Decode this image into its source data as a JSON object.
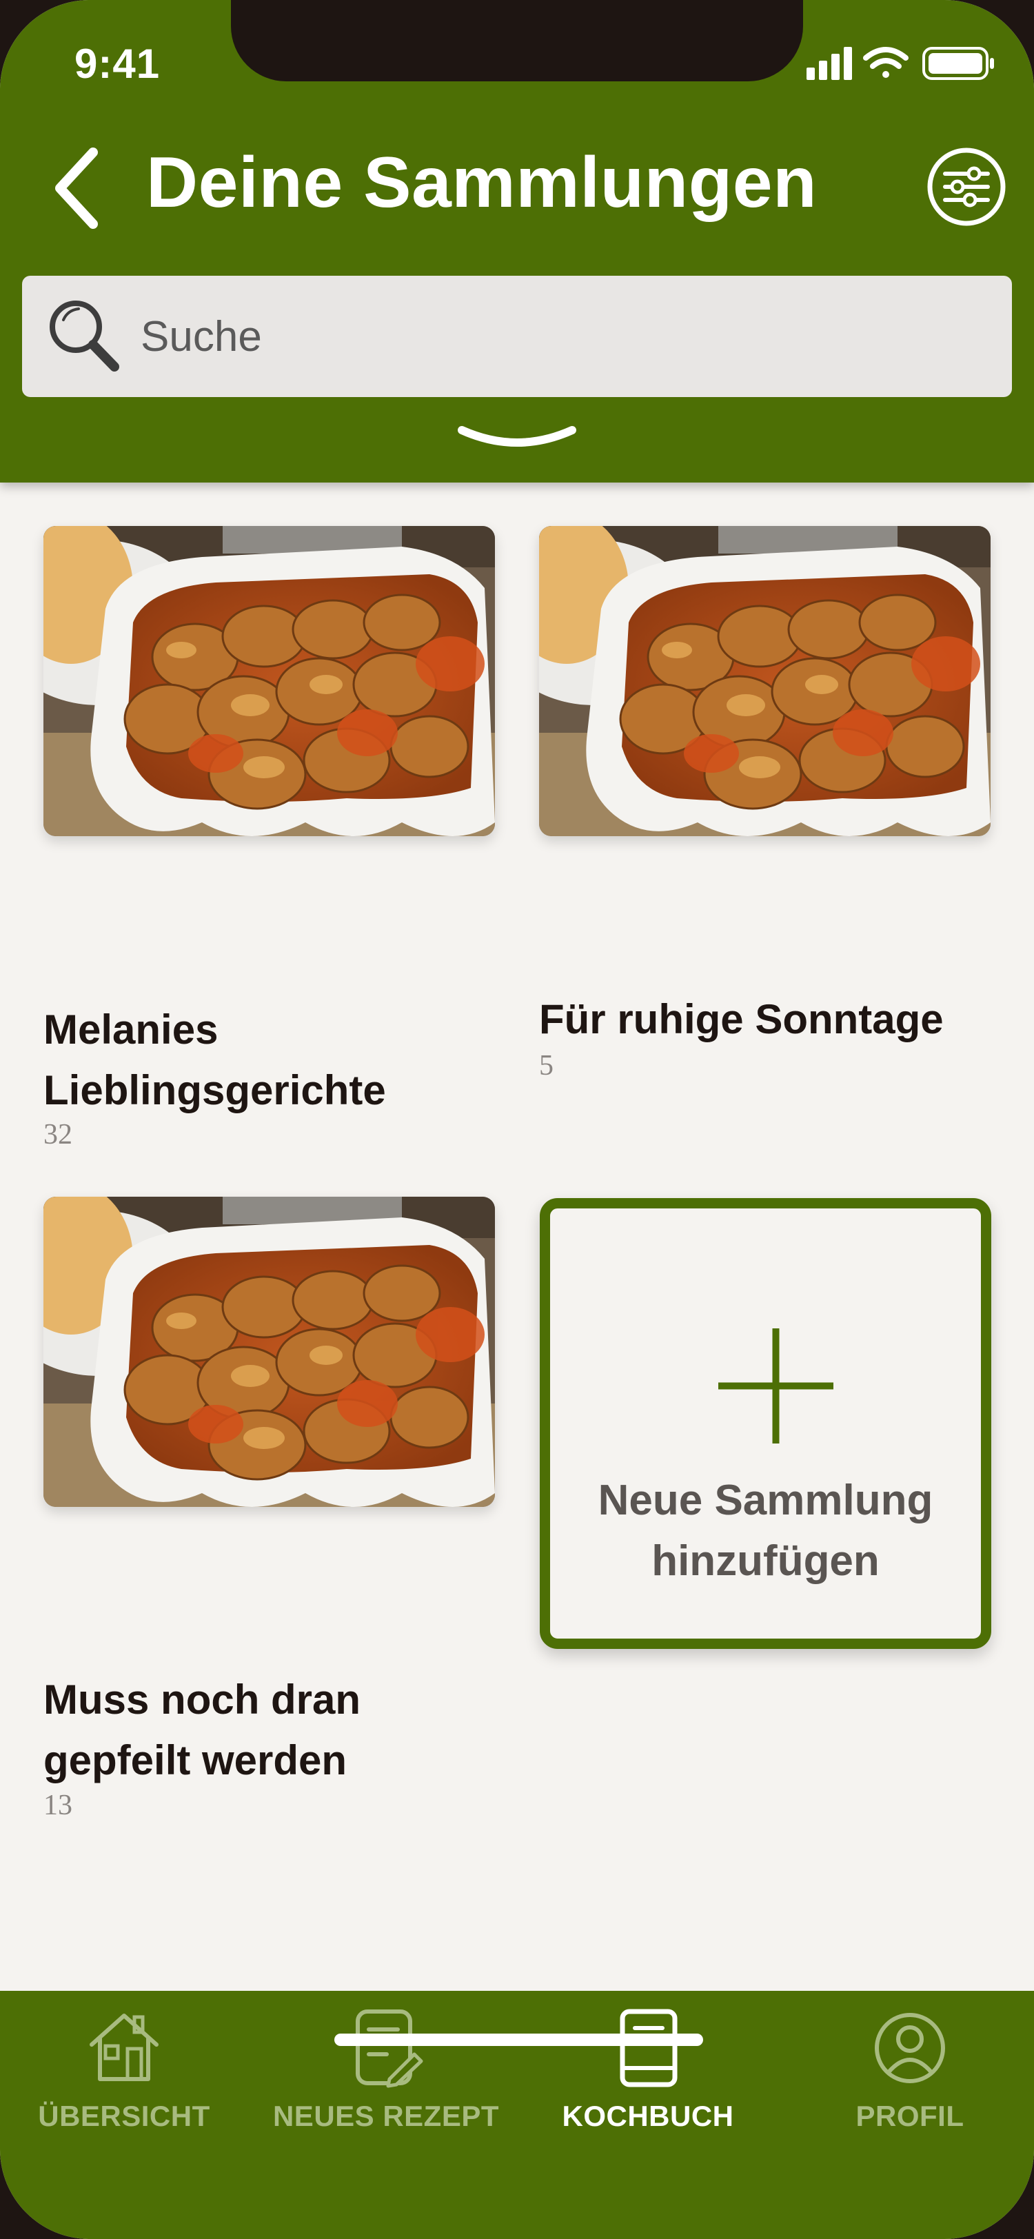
{
  "status_bar": {
    "time": "9:41"
  },
  "header": {
    "title": "Deine Sammlungen",
    "back_icon": "chevron-left-icon",
    "filter_icon": "sliders-icon",
    "expand_icon": "chevron-down-icon"
  },
  "search": {
    "placeholder": "Suche",
    "value": ""
  },
  "collections": [
    {
      "title": "Melanies Lieblingsgerichte",
      "count": "32",
      "image": "currywurst-photo"
    },
    {
      "title": "Für ruhige Sonntage",
      "count": "5",
      "image": "currywurst-photo"
    },
    {
      "title": "Muss noch dran gepfeilt werden",
      "count": "13",
      "image": "currywurst-photo"
    }
  ],
  "add_collection": {
    "label": "Neue Sammlung hinzufügen",
    "icon": "plus-icon"
  },
  "tabs": [
    {
      "label": "ÜBERSICHT",
      "icon": "home-icon",
      "active": false
    },
    {
      "label": "NEUES REZEPT",
      "icon": "note-edit-icon",
      "active": false
    },
    {
      "label": "KOCHBUCH",
      "icon": "book-icon",
      "active": true
    },
    {
      "label": "PROFIL",
      "icon": "user-icon",
      "active": false
    }
  ],
  "colors": {
    "brand_green": "#4d6f05",
    "background": "#f5f3f0",
    "text_dark": "#1e1512",
    "inactive_tab": "#a8bb80"
  }
}
